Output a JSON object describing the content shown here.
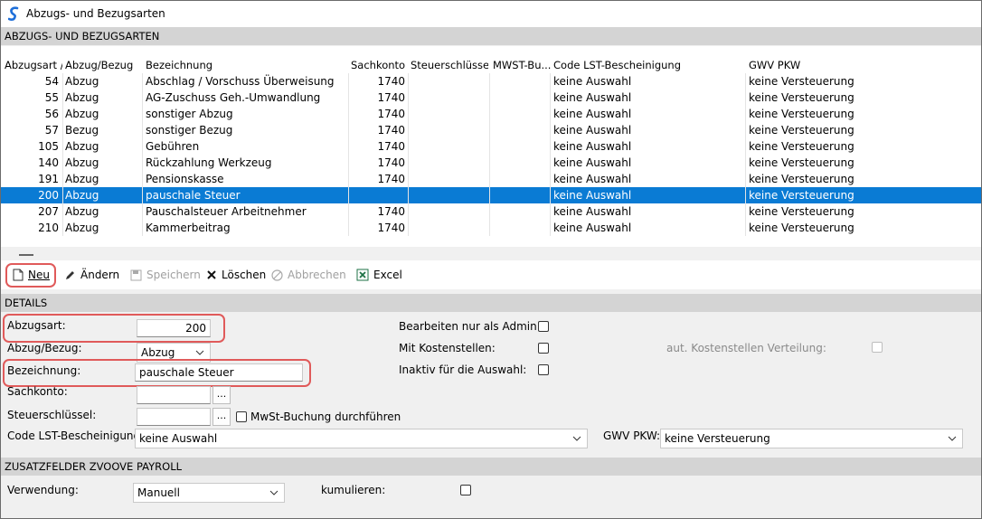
{
  "window": {
    "title": "Abzugs- und Bezugsarten"
  },
  "grid_section": {
    "title": "ABZUGS- UND BEZUGSARTEN"
  },
  "columns": [
    "Abzugsart",
    "Abzug/Bezug",
    "Bezeichnung",
    "Sachkonto",
    "Steuerschlüssel",
    "MWST-Bu...",
    "Code LST-Bescheinigung",
    "GWV PKW"
  ],
  "rows": [
    {
      "nr": "54",
      "typ": "Abzug",
      "bez": "Abschlag / Vorschuss Überweisung",
      "konto": "1740",
      "code": "keine Auswahl",
      "gwv": "keine Versteuerung"
    },
    {
      "nr": "55",
      "typ": "Abzug",
      "bez": "AG-Zuschuss Geh.-Umwandlung",
      "konto": "1740",
      "code": "keine Auswahl",
      "gwv": "keine Versteuerung"
    },
    {
      "nr": "56",
      "typ": "Abzug",
      "bez": "sonstiger Abzug",
      "konto": "1740",
      "code": "keine Auswahl",
      "gwv": "keine Versteuerung"
    },
    {
      "nr": "57",
      "typ": "Bezug",
      "bez": "sonstiger Bezug",
      "konto": "1740",
      "code": "keine Auswahl",
      "gwv": "keine Versteuerung"
    },
    {
      "nr": "105",
      "typ": "Abzug",
      "bez": "Gebühren",
      "konto": "1740",
      "code": "keine Auswahl",
      "gwv": "keine Versteuerung"
    },
    {
      "nr": "140",
      "typ": "Abzug",
      "bez": "Rückzahlung Werkzeug",
      "konto": "1740",
      "code": "keine Auswahl",
      "gwv": "keine Versteuerung"
    },
    {
      "nr": "191",
      "typ": "Abzug",
      "bez": "Pensionskasse",
      "konto": "1740",
      "code": "keine Auswahl",
      "gwv": "keine Versteuerung"
    },
    {
      "nr": "200",
      "typ": "Abzug",
      "bez": "pauschale Steuer",
      "konto": "",
      "code": "keine Auswahl",
      "gwv": "keine Versteuerung",
      "selected": true
    },
    {
      "nr": "207",
      "typ": "Abzug",
      "bez": "Pauschalsteuer Arbeitnehmer",
      "konto": "1740",
      "code": "keine Auswahl",
      "gwv": "keine Versteuerung"
    },
    {
      "nr": "210",
      "typ": "Abzug",
      "bez": "Kammerbeitrag",
      "konto": "1740",
      "code": "keine Auswahl",
      "gwv": "keine Versteuerung"
    }
  ],
  "toolbar": {
    "new": "Neu",
    "edit": "Ändern",
    "save": "Speichern",
    "delete": "Löschen",
    "cancel": "Abbrechen",
    "excel": "Excel"
  },
  "details": {
    "title": "DETAILS",
    "abzugsart_label": "Abzugsart:",
    "abzugsart_value": "200",
    "abzug_bezug_label": "Abzug/Bezug:",
    "abzug_bezug_value": "Abzug",
    "bezeichnung_label": "Bezeichnung:",
    "bezeichnung_value": "pauschale Steuer",
    "sachkonto_label": "Sachkonto:",
    "steuer_label": "Steuerschlüssel:",
    "mwst_label": "MwSt-Buchung durchführen",
    "code_label": "Code LST-Bescheinigung:",
    "code_value": "keine Auswahl",
    "gwv_label": "GWV PKW:",
    "gwv_value": "keine Versteuerung",
    "admin_label": "Bearbeiten nur als Admin.:",
    "kostenstellen_label": "Mit Kostenstellen:",
    "inaktiv_label": "Inaktiv für die Auswahl:",
    "kst_verteilung_label": "aut. Kostenstellen Verteilung:"
  },
  "zusatz": {
    "title": "ZUSATZFELDER ZVOOVE PAYROLL",
    "verwendung_label": "Verwendung:",
    "verwendung_value": "Manuell",
    "kumulieren_label": "kumulieren:"
  },
  "colors": {
    "selection": "#0a7bd4",
    "highlight": "#e05a5a",
    "section": "#d4d4d4"
  }
}
